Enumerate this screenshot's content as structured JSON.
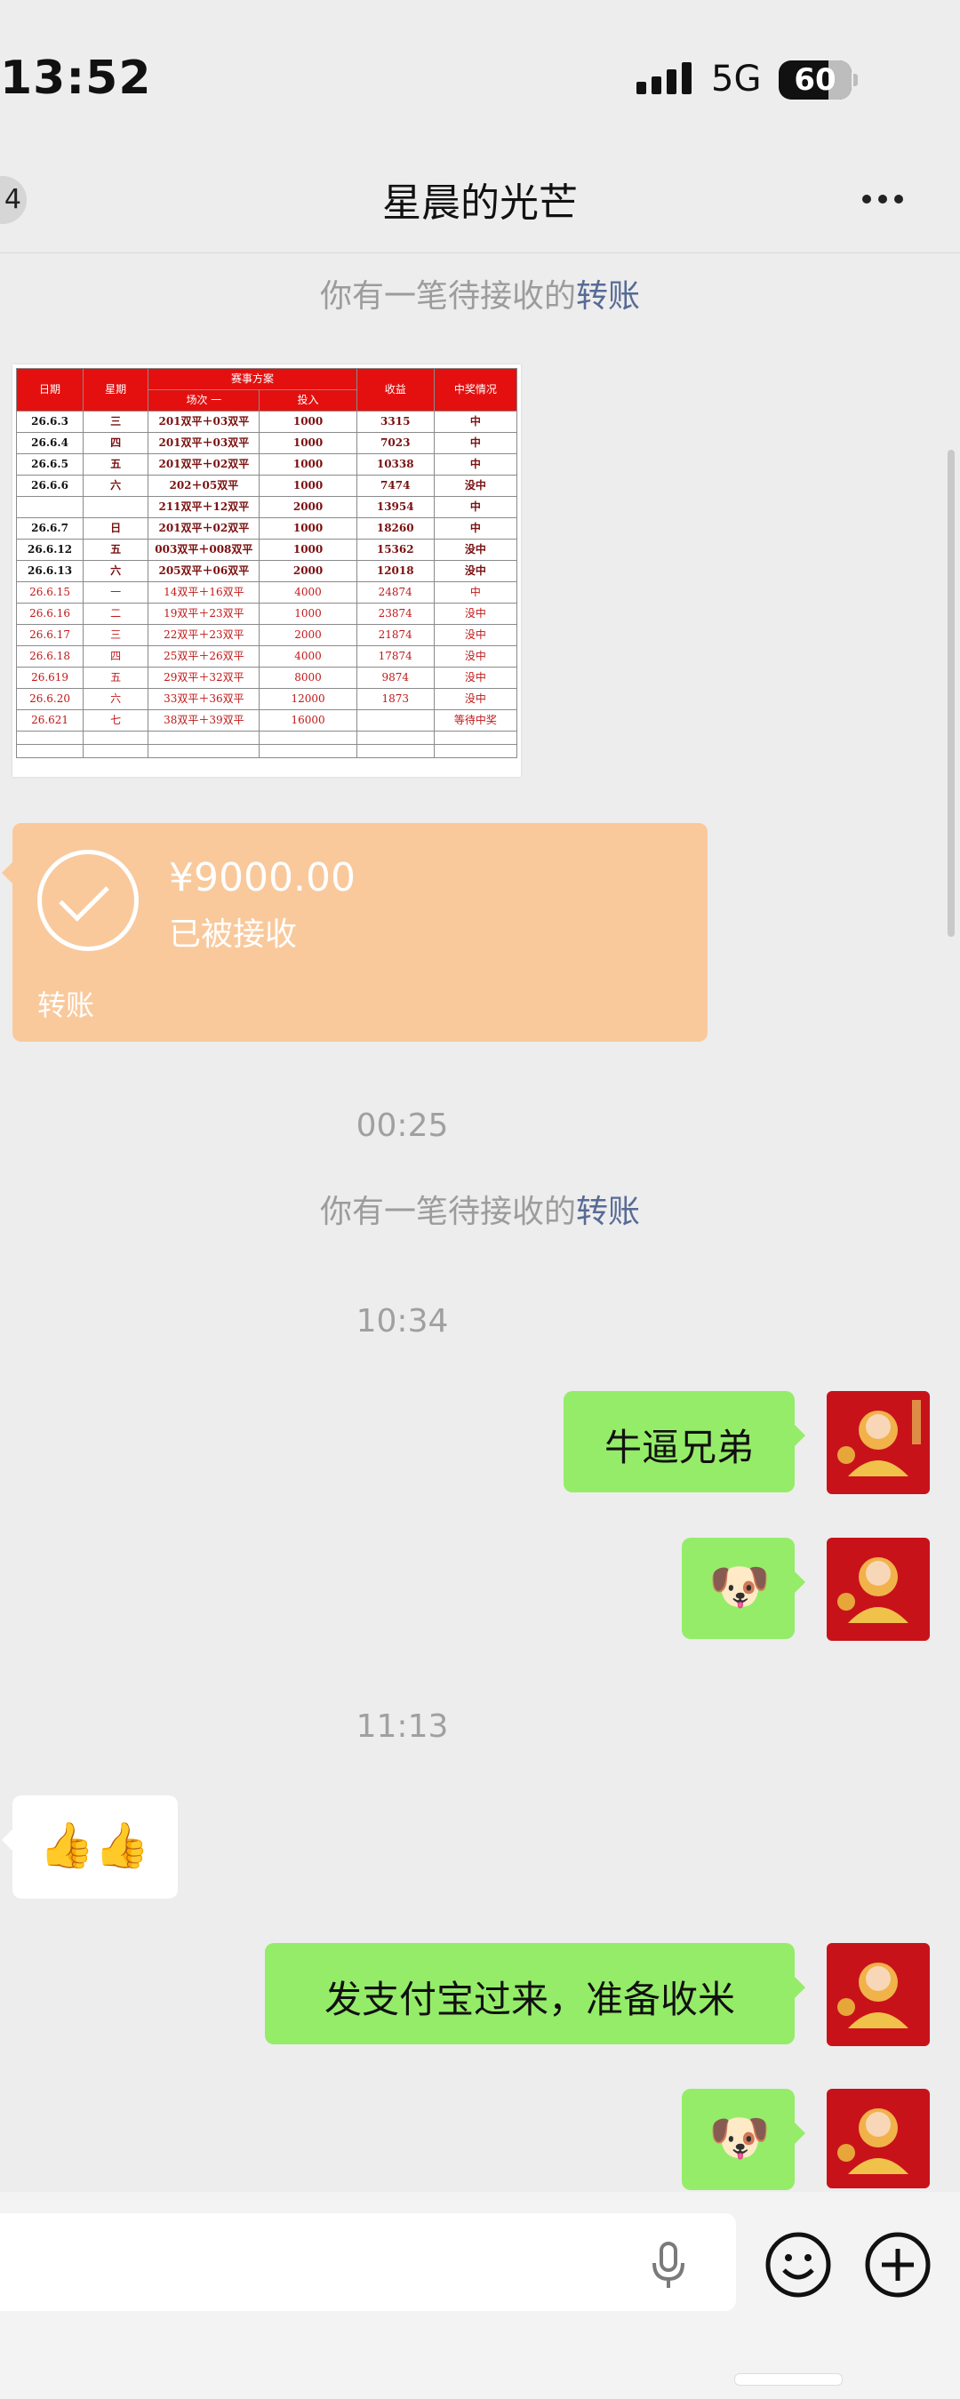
{
  "status_bar": {
    "time": "13:52",
    "network": "5G",
    "battery": "60"
  },
  "nav": {
    "back_badge": "4",
    "title": "星晨的光芒"
  },
  "system_notice": {
    "prefix": "你有一笔待接收的",
    "link": "转账"
  },
  "table": {
    "header_top": [
      "日期",
      "星期",
      "赛事方案",
      "收益",
      "中奖情况"
    ],
    "header_sub": [
      "场次 一",
      "投入"
    ],
    "rows": [
      [
        "26.6.3",
        "三",
        "201双平＋03双平",
        "1000",
        "3315",
        "中"
      ],
      [
        "26.6.4",
        "四",
        "201双平＋03双平",
        "1000",
        "7023",
        "中"
      ],
      [
        "26.6.5",
        "五",
        "201双平＋02双平",
        "1000",
        "10338",
        "中"
      ],
      [
        "26.6.6",
        "六",
        "202＋05双平",
        "1000",
        "7474",
        "没中"
      ],
      [
        "",
        "",
        "211双平＋12双平",
        "2000",
        "13954",
        "中"
      ],
      [
        "26.6.7",
        "日",
        "201双平＋02双平",
        "1000",
        "18260",
        "中"
      ],
      [
        "26.6.12",
        "五",
        "003双平＋008双平",
        "1000",
        "15362",
        "没中"
      ],
      [
        "26.6.13",
        "六",
        "205双平＋06双平",
        "2000",
        "12018",
        "没中"
      ],
      [
        "26.6.15",
        "一",
        "14双平＋16双平",
        "4000",
        "24874",
        "中"
      ],
      [
        "26.6.16",
        "二",
        "19双平＋23双平",
        "1000",
        "23874",
        "没中"
      ],
      [
        "26.6.17",
        "三",
        "22双平＋23双平",
        "2000",
        "21874",
        "没中"
      ],
      [
        "26.6.18",
        "四",
        "25双平＋26双平",
        "4000",
        "17874",
        "没中"
      ],
      [
        "26.619",
        "五",
        "29双平＋32双平",
        "8000",
        "9874",
        "没中"
      ],
      [
        "26.6.20",
        "六",
        "33双平＋36双平",
        "12000",
        "1873",
        "没中"
      ],
      [
        "26.621",
        "七",
        "38双平＋39双平",
        "16000",
        "",
        "等待中奖"
      ]
    ]
  },
  "transfer": {
    "amount": "¥9000.00",
    "status": "已被接收",
    "label": "转账"
  },
  "timestamps": {
    "t1": "00:25",
    "t2": "10:34",
    "t3": "11:13"
  },
  "messages": {
    "m1": "牛逼兄弟",
    "m2_emoji": "🐶",
    "m3_emoji": "👍👍",
    "m4": "发支付宝过来，准备收米",
    "m5_emoji": "🐶"
  },
  "icons": [
    "back-badge",
    "more-icon",
    "checkmark-icon",
    "mic-icon",
    "emoji-icon",
    "plus-icon",
    "signal-icon",
    "battery-icon"
  ],
  "colors": {
    "chat_bg": "#ededed",
    "my_bubble": "#95ec69",
    "transfer_card": "#f9c99c",
    "link": "#576b95",
    "table_header": "#e4100f"
  }
}
